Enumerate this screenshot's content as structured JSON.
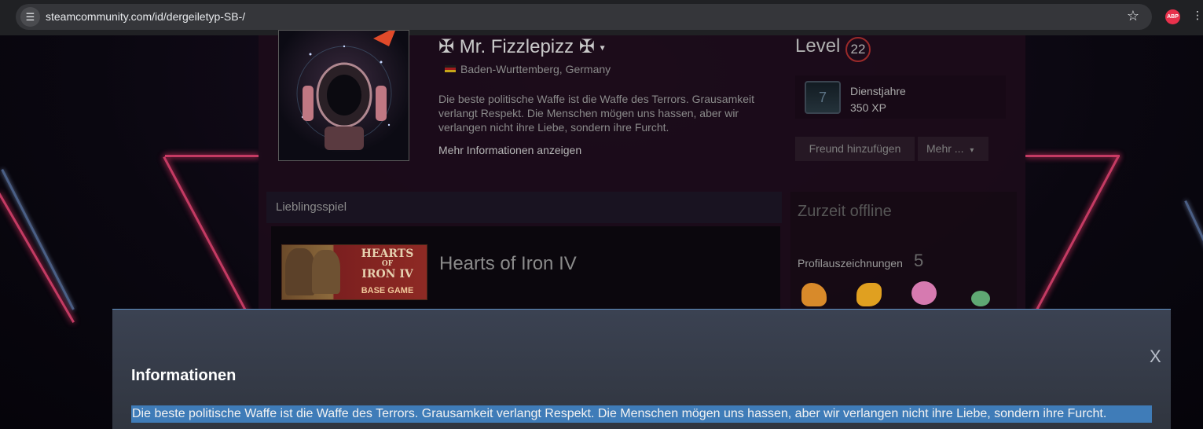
{
  "browser": {
    "url": "steamcommunity.com/id/dergeiletyp-SB-/",
    "site_info_icon": "tune-icon",
    "bookmark_icon": "star-icon",
    "extension_abp_label": "ABP",
    "extension_2_icon": "puzzle-icon"
  },
  "profile": {
    "persona_name": "✠ Mr. Fizzlepizz ✠",
    "location": "Baden-Wurttemberg, Germany",
    "summary": "Die beste politische Waffe ist die Waffe des Terrors. Grausamkeit verlangt Respekt. Die Menschen mögen uns hassen, aber wir verlangen nicht ihre Liebe, sondern ihre Furcht.",
    "more_info_link": "Mehr Informationen anzeigen"
  },
  "level": {
    "label": "Level",
    "value": "22",
    "badge_name": "Dienstjahre",
    "badge_xp": "350 XP",
    "badge_icon_text": "7"
  },
  "actions": {
    "add_friend": "Freund hinzufügen",
    "more": "Mehr ..."
  },
  "favorite_game": {
    "header": "Lieblingsspiel",
    "name": "Hearts of Iron IV",
    "capsule_title_1": "HEARTS",
    "capsule_title_2": "OF",
    "capsule_title_3": "IRON IV",
    "capsule_subtitle": "BASE GAME"
  },
  "status": {
    "online": "Zurzeit offline",
    "awards_label": "Profilauszeichnungen",
    "awards_count": "5"
  },
  "modal": {
    "title": "Informationen",
    "close": "X",
    "text": "Die beste politische Waffe ist die Waffe des Terrors. Grausamkeit verlangt Respekt. Die Menschen mögen uns hassen, aber wir verlangen nicht ihre Liebe, sondern ihre Furcht."
  },
  "colors": {
    "modal_accent": "#5e8fc4",
    "selection": "#3f7cb8",
    "level_ring": "#9b2a2a"
  }
}
